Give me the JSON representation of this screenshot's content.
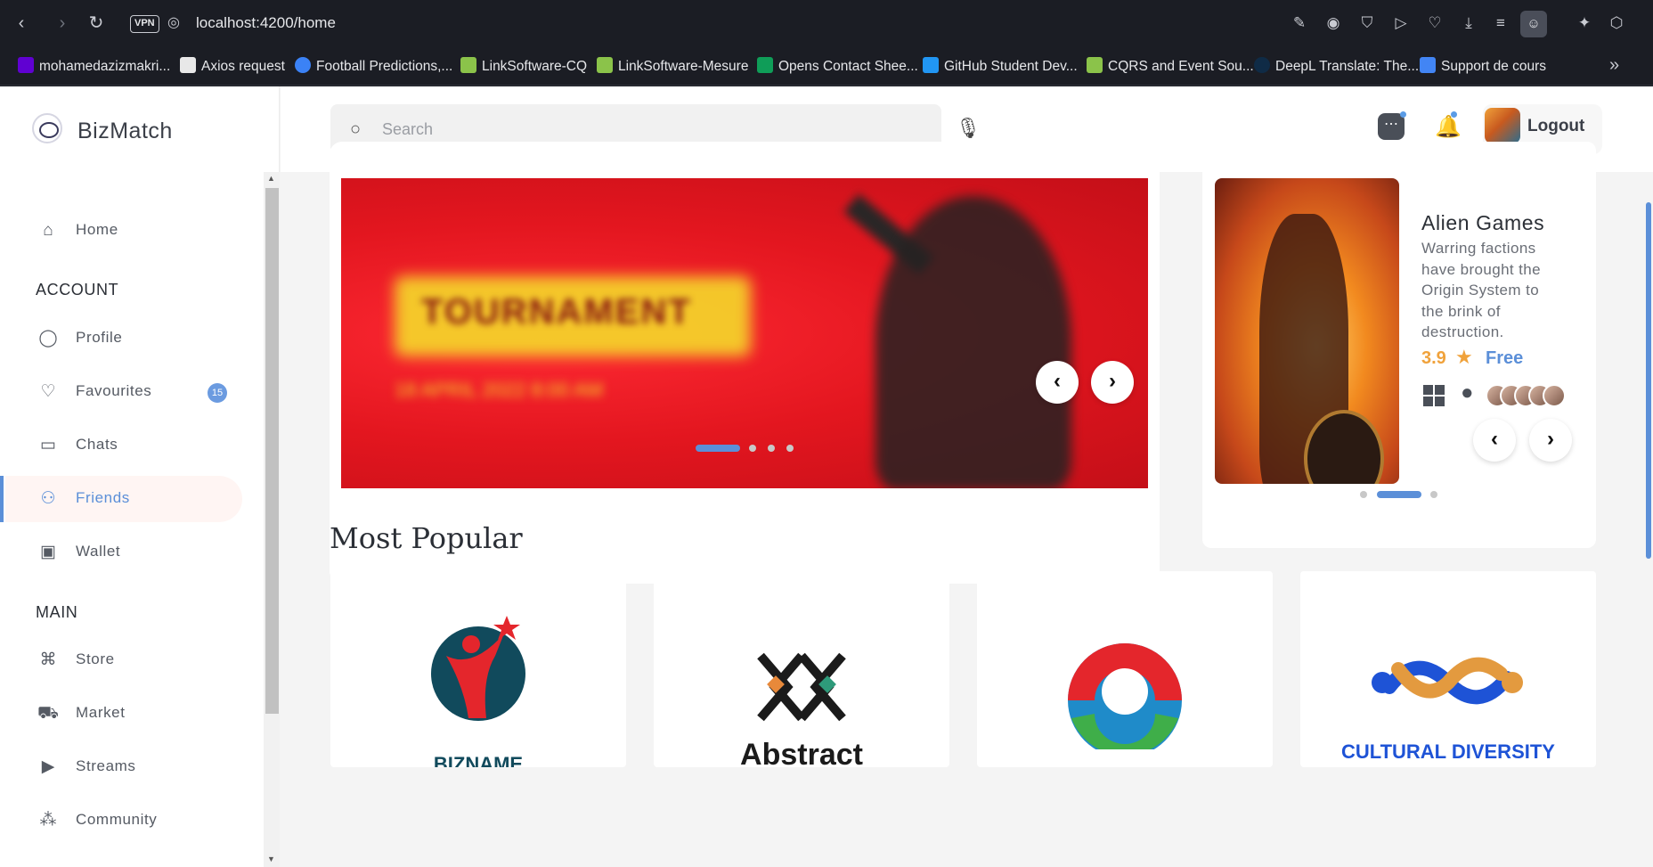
{
  "browser": {
    "url_host": "localhost",
    "url_path": ":4200/home",
    "vpn_label": "VPN"
  },
  "bookmarks": [
    {
      "label": "mohamedazizmakri...",
      "color": "#6001d2"
    },
    {
      "label": "Axios request",
      "color": "#e8e8e8"
    },
    {
      "label": "Football Predictions,...",
      "color": "#3b82f6"
    },
    {
      "label": "LinkSoftware-CQ",
      "color": "#8bc34a"
    },
    {
      "label": "LinkSoftware-Mesure",
      "color": "#8bc34a"
    },
    {
      "label": "Opens Contact Shee...",
      "color": "#0f9d58"
    },
    {
      "label": "GitHub Student Dev...",
      "color": "#2196f3"
    },
    {
      "label": "CQRS and Event Sou...",
      "color": "#8bc34a"
    },
    {
      "label": "DeepL Translate: The...",
      "color": "#0f2b46"
    },
    {
      "label": "Support de cours",
      "color": "#4285f4"
    }
  ],
  "app": {
    "brand": "BizMatch",
    "search_placeholder": "Search",
    "logout_label": "Logout",
    "accent": "#5b8fd8"
  },
  "sidebar": {
    "home": "Home",
    "account_title": "ACCOUNT",
    "profile": "Profile",
    "favourites": "Favourites",
    "favourites_badge": "15",
    "chats": "Chats",
    "friends": "Friends",
    "wallet": "Wallet",
    "main_title": "MAIN",
    "store": "Store",
    "market": "Market",
    "streams": "Streams",
    "community": "Community"
  },
  "banner": {
    "title": "TOURNAMENT",
    "subtitle": "18 APRIL 2022   8:00 AM"
  },
  "featured_game": {
    "title": "Alien Games",
    "description": "Warring factions have brought the Origin System to the brink of destruction.",
    "rating": "3.9",
    "price": "Free"
  },
  "most_popular": {
    "title": "Most Popular",
    "cards": [
      {
        "name": "BIZNAME"
      },
      {
        "name": "Abstract"
      },
      {
        "name": ""
      },
      {
        "name": "CULTURAL DIVERSITY"
      }
    ]
  }
}
